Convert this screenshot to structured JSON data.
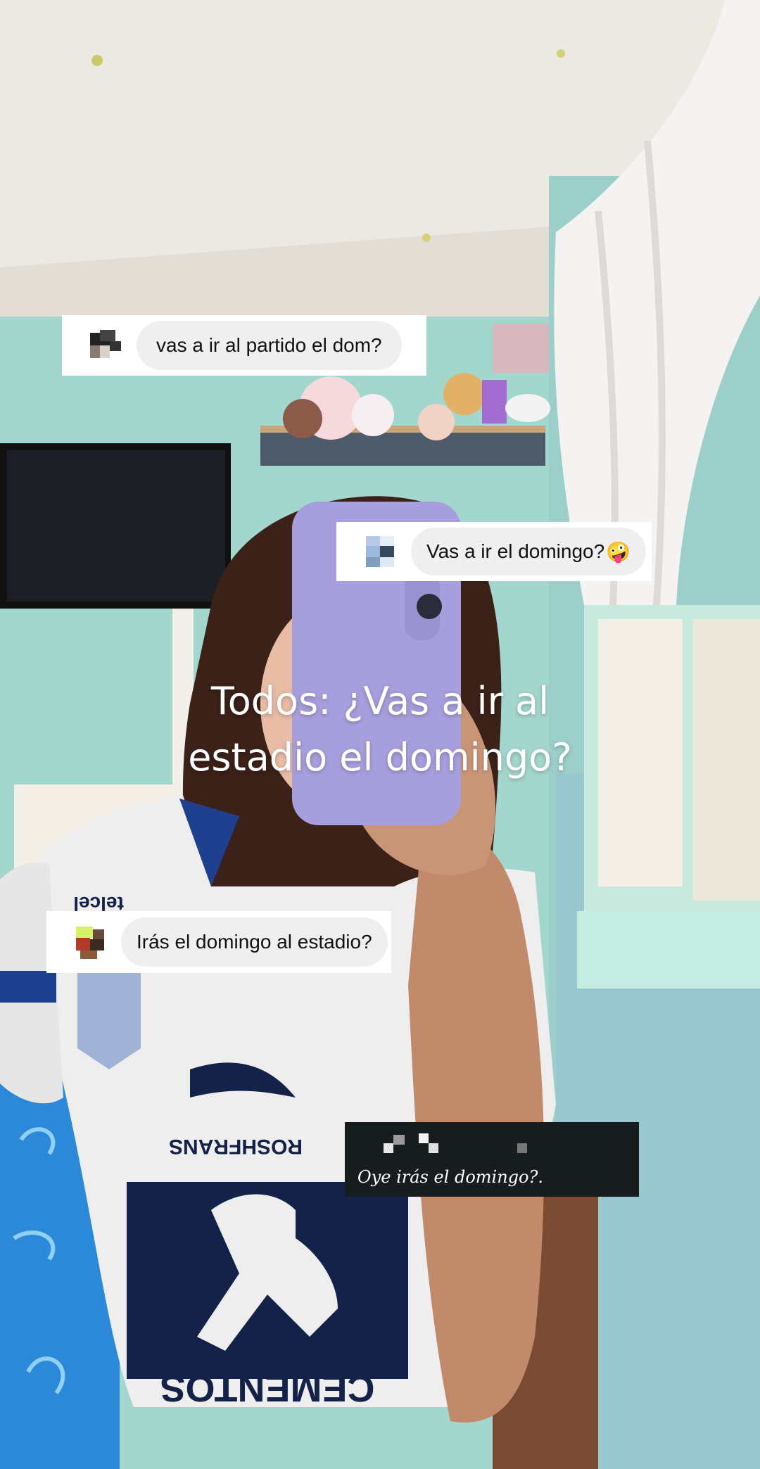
{
  "messages": [
    {
      "text": "vas a ir al partido el dom?",
      "avatar_icon": "pixelated-avatar-icon"
    },
    {
      "text": "Vas a ir el domingo?",
      "emoji": "🤪",
      "avatar_icon": "pixelated-avatar-icon"
    },
    {
      "text": "Irás el domingo al estadio?",
      "avatar_icon": "pixelated-avatar-icon"
    },
    {
      "text": "Oye irás el domingo?.",
      "avatar_icon": "pixelated-name-icon"
    }
  ],
  "caption": {
    "line1": "Todos: ¿Vas a ir al",
    "line2": "estadio el domingo?"
  },
  "jersey": {
    "sponsor": "ROSHFRANS",
    "brand": "CEMENTOS",
    "carrier": "telcel"
  },
  "colors": {
    "wall": "#9fd6cc",
    "ceiling": "#ece9e2",
    "phone_case": "#a79fdd",
    "card": "#ffffff",
    "pill": "#efefef",
    "dark_card": "#171c1f",
    "jersey_blue": "#1f3f8f"
  }
}
